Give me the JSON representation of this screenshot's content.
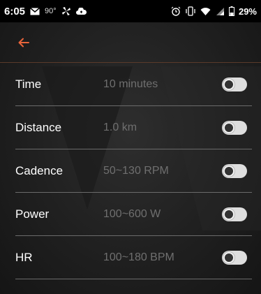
{
  "status_bar": {
    "time": "6:05",
    "temperature": "90°",
    "battery": "29%",
    "icons": [
      "mail-icon",
      "fan-icon",
      "cloud-upload-icon",
      "alarm-icon",
      "vibrate-icon",
      "wifi-icon",
      "signal-icon",
      "battery-icon"
    ]
  },
  "colors": {
    "accent": "#e8643a",
    "background": "#222222",
    "value_text": "#6f6f6f",
    "toggle_track": "#dedede"
  },
  "settings": [
    {
      "label": "Time",
      "value": "10 minutes",
      "enabled": false
    },
    {
      "label": "Distance",
      "value": "1.0 km",
      "enabled": false
    },
    {
      "label": "Cadence",
      "value": "50~130 RPM",
      "enabled": false
    },
    {
      "label": "Power",
      "value": "100~600 W",
      "enabled": false
    },
    {
      "label": "HR",
      "value": "100~180 BPM",
      "enabled": false
    }
  ]
}
